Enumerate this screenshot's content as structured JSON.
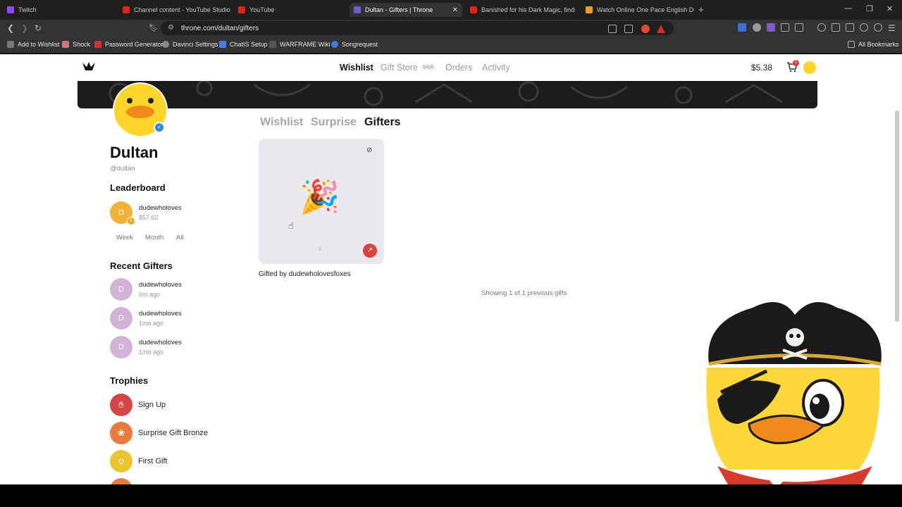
{
  "browser": {
    "tabs": [
      {
        "title": "Twitch",
        "color": "#9146ff"
      },
      {
        "title": "Channel content - YouTube Studio",
        "color": "#e62117"
      },
      {
        "title": "YouTube",
        "color": "#e62117"
      },
      {
        "title": "Dultan - Gifters | Throne",
        "color": "#6b5bd6",
        "active": true
      },
      {
        "title": "Banished for his Dark Magic, finds his",
        "color": "#e62117"
      },
      {
        "title": "Watch Online One Pace English Dub",
        "color": "#f0a020"
      }
    ],
    "url": "throne.com/dultan/gifters",
    "bookmarks": [
      "Add to Wishlist",
      "Shock",
      "Password Generator",
      "Davinci Settings",
      "ChatIS Setup",
      "WARFRAME Wiki",
      "Songrequest"
    ],
    "all_bookmarks": "All Bookmarks"
  },
  "site": {
    "nav": {
      "wishlist": "Wishlist",
      "gift_store": "Gift Store",
      "sale": "SALE",
      "orders": "Orders",
      "activity": "Activity"
    },
    "balance": "$5.38",
    "cart_count": "1"
  },
  "profile": {
    "name": "Dultan",
    "handle": "@dultan",
    "leaderboard_title": "Leaderboard",
    "leader": {
      "name": "dudewholoves",
      "amount": "$57.62",
      "initial": "D",
      "rank": "1"
    },
    "periods": [
      "Week",
      "Month",
      "All"
    ],
    "recent_title": "Recent Gifters",
    "recent": [
      {
        "name": "dudewholoves",
        "time": "6m ago",
        "initial": "D"
      },
      {
        "name": "dudewholoves",
        "time": "1mo ago",
        "initial": "D"
      },
      {
        "name": "dudewholoves",
        "time": "1mo ago",
        "initial": "D"
      }
    ],
    "trophies_title": "Trophies",
    "trophies": [
      {
        "name": "Sign Up",
        "color": "#d64545"
      },
      {
        "name": "Surprise Gift Bronze",
        "color": "#e87a3c"
      },
      {
        "name": "First Gift",
        "color": "#e9c531"
      }
    ]
  },
  "content": {
    "tabs": [
      "Wishlist",
      "Surprise",
      "Gifters"
    ],
    "active_tab": "Gifters",
    "gift": {
      "gifted_by": "Gifted by dudewholovesfoxes",
      "emoji": "🎉"
    },
    "showing": "Showing 1 of 1 previous gifts"
  }
}
